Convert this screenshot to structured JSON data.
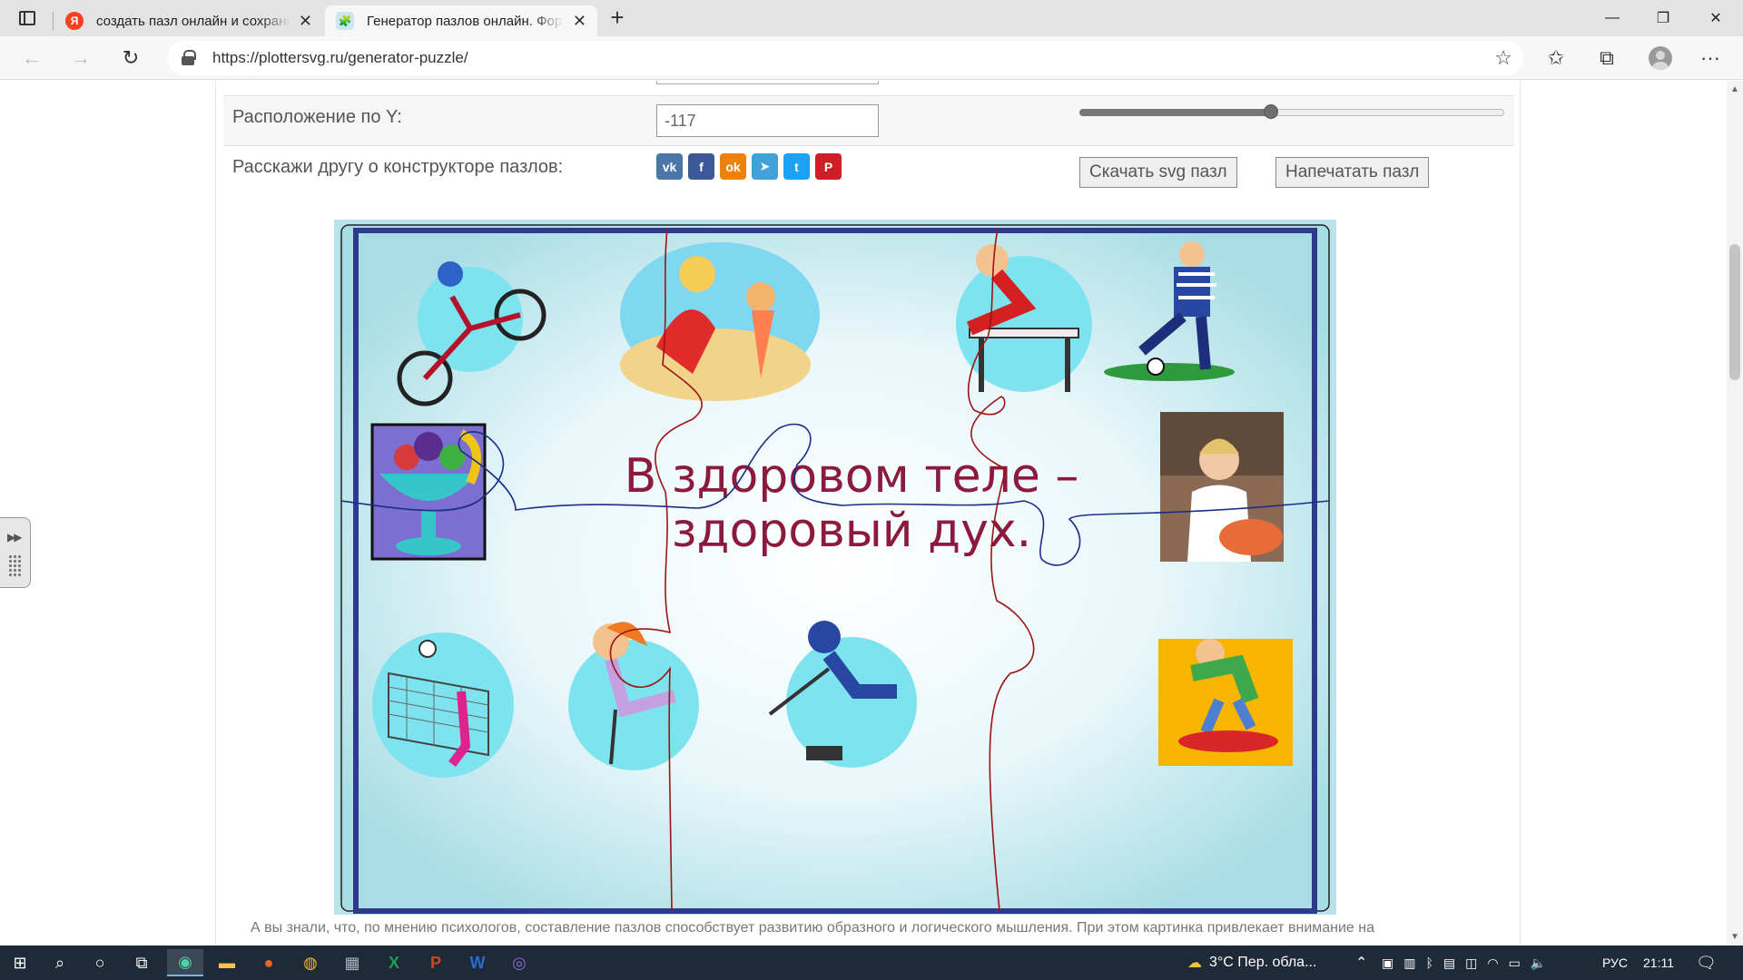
{
  "browser": {
    "tabs": [
      {
        "favicon": "Я",
        "title": "создать пазл онлайн и сохрани"
      },
      {
        "favicon": "🧩",
        "title": "Генератор пазлов онлайн. Фор"
      }
    ],
    "url": "https://plottersvg.ru/generator-puzzle/"
  },
  "controls": {
    "y_label": "Расположение по Y:",
    "y_value": "-117",
    "y_slider_fraction": 0.45,
    "share_label": "Расскажи другу о конструкторе пазлов:",
    "share_buttons": [
      {
        "glyph": "vk",
        "color": "#4a76a8"
      },
      {
        "glyph": "f",
        "color": "#3b5998"
      },
      {
        "glyph": "ok",
        "color": "#ee8208"
      },
      {
        "glyph": "➤",
        "color": "#40a2d6"
      },
      {
        "glyph": "t",
        "color": "#1da1f2"
      },
      {
        "glyph": "P",
        "color": "#cb2027"
      }
    ],
    "download_label": "Скачать svg пазл",
    "print_label": "Напечатать пазл"
  },
  "puzzle": {
    "line1": "В здоровом теле –",
    "line2": "здоровый дух."
  },
  "caption": "А вы знали, что, по мнению психологов, составление пазлов способствует развитию образного и логического мышления. При этом картинка привлекает внимание на",
  "taskbar": {
    "weather": "3°C  Пер. обла...",
    "lang": "РУС",
    "time": "21:11"
  }
}
